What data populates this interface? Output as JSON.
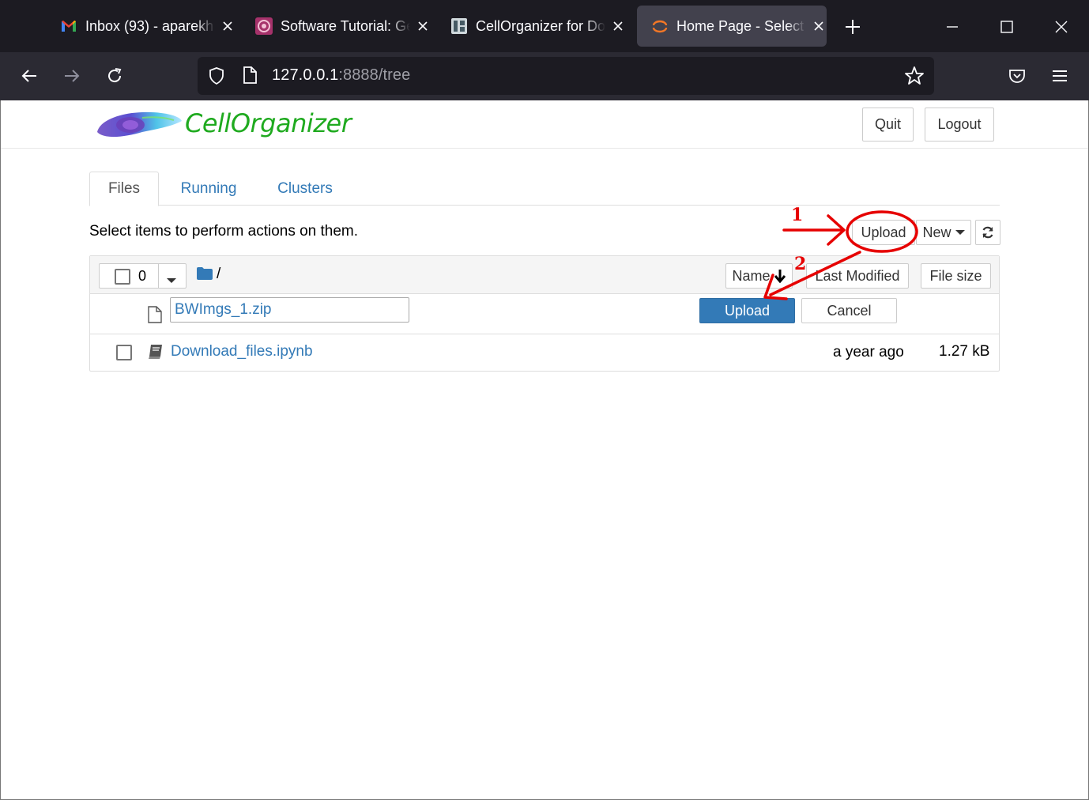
{
  "browser": {
    "tabs": [
      {
        "title": "Inbox (93) - aparekh",
        "favicon": "gmail-icon"
      },
      {
        "title": "Software Tutorial: Ge",
        "favicon": "software-tutorial-icon"
      },
      {
        "title": "CellOrganizer for Do",
        "favicon": "cellorganizer-icon"
      },
      {
        "title": "Home Page - Select o",
        "favicon": "jupyter-icon",
        "active": true
      }
    ],
    "url_host": "127.0.0.1",
    "url_rest": ":8888/tree"
  },
  "header": {
    "logo_text": "CellOrganizer",
    "quit_label": "Quit",
    "logout_label": "Logout"
  },
  "tabs": {
    "files": "Files",
    "running": "Running",
    "clusters": "Clusters"
  },
  "toolbar": {
    "hint": "Select items to perform actions on them.",
    "upload_label": "Upload",
    "new_label": "New"
  },
  "list_header": {
    "selected_count": "0",
    "path": "/",
    "name_col": "Name",
    "last_modified_col": "Last Modified",
    "file_size_col": "File size"
  },
  "upload_row": {
    "filename": "BWImgs_1.zip",
    "upload_label": "Upload",
    "cancel_label": "Cancel"
  },
  "files": [
    {
      "name": "Download_files.ipynb",
      "modified": "a year ago",
      "size": "1.27 kB"
    }
  ],
  "annotations": {
    "step1": "1",
    "step2": "2",
    "color": "#e60000"
  }
}
